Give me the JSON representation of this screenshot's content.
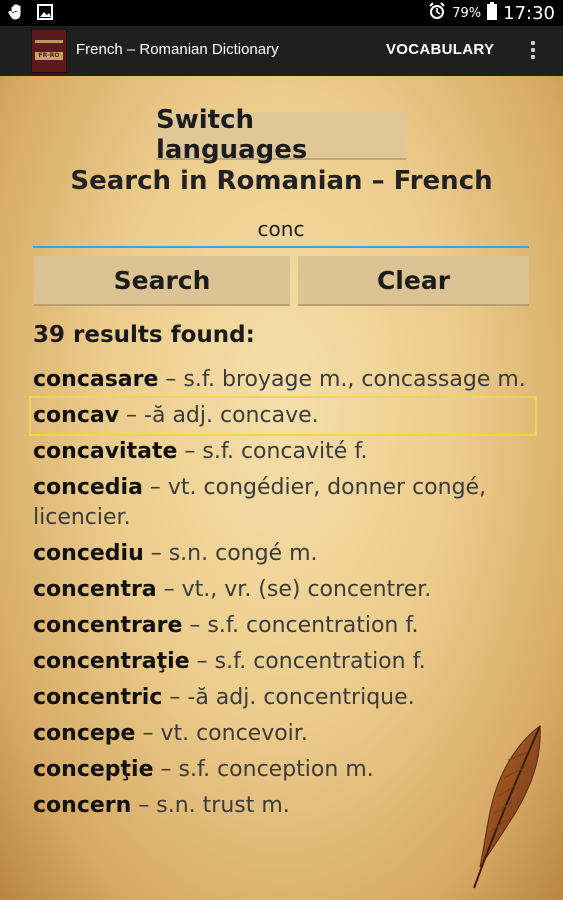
{
  "status_bar": {
    "battery_percent": "79%",
    "time": "17:30",
    "icons": [
      "hand-icon",
      "image-icon",
      "alarm-icon",
      "battery-icon"
    ]
  },
  "app_bar": {
    "title": "French – Romanian Dictionary",
    "vocabulary_label": "VOCABULARY",
    "logo_text": "FR-RO"
  },
  "main": {
    "switch_label": "Switch languages",
    "heading": "Search in Romanian – French",
    "query": "conc",
    "search_label": "Search",
    "clear_label": "Clear",
    "results_count": "39 results found:",
    "entries": [
      {
        "term": "concasare",
        "def": " – s.f. broyage m., concassage m."
      },
      {
        "term": "concav",
        "def": " – -ă adj. concave."
      },
      {
        "term": "concavitate",
        "def": " – s.f. concavité f."
      },
      {
        "term": "concedia",
        "def": " – vt. congédier, donner congé, licencier."
      },
      {
        "term": "concediu",
        "def": " – s.n. congé m."
      },
      {
        "term": "concentra",
        "def": " – vt., vr. (se) concentrer."
      },
      {
        "term": "concentrare",
        "def": " – s.f. concentration f."
      },
      {
        "term": "concentraţie",
        "def": " – s.f. concentration f."
      },
      {
        "term": "concentric",
        "def": " – -ă adj. concentrique."
      },
      {
        "term": "concepe",
        "def": " – vt. concevoir."
      },
      {
        "term": "concepţie",
        "def": " – s.f. conception m."
      },
      {
        "term": "concern",
        "def": " – s.n. trust m."
      }
    ],
    "selected_index": 1
  },
  "colors": {
    "accent": "#4a9ec9",
    "selection": "#ecd84c",
    "app_bar": "#1f1f1f"
  }
}
